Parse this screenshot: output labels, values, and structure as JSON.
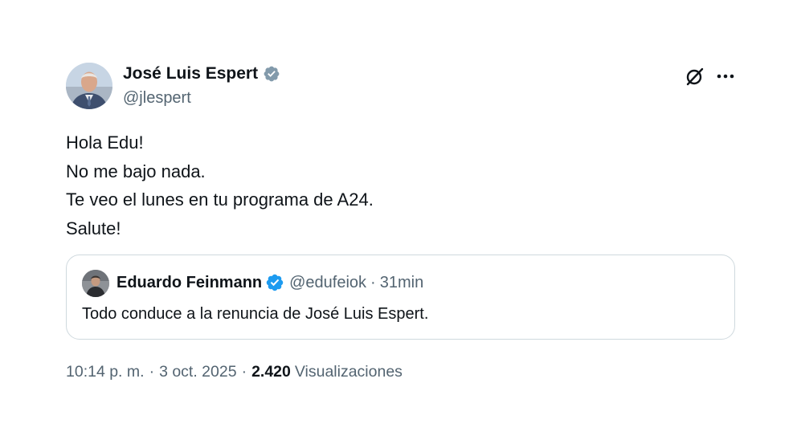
{
  "tweet": {
    "author": {
      "name": "José Luis Espert",
      "handle": "@jlespert",
      "verified": true,
      "verified_color": "#829aab"
    },
    "text_lines": [
      "Hola Edu!",
      "No me bajo nada.",
      "Te veo el lunes en tu programa de A24.",
      "Salute!"
    ],
    "quoted": {
      "name": "Eduardo Feinmann",
      "handle": "@edufeiok",
      "separator": "·",
      "time": "31min",
      "verified": true,
      "verified_color": "#1d9bf0",
      "text": "Todo conduce a la renuncia de José Luis Espert."
    },
    "meta": {
      "time": "10:14 p. m.",
      "separator": "·",
      "date": "3 oct. 2025",
      "views_count": "2.420",
      "views_label": "Visualizaciones"
    },
    "icons": {
      "grok": "grok-icon",
      "more": "more-options-icon"
    }
  }
}
